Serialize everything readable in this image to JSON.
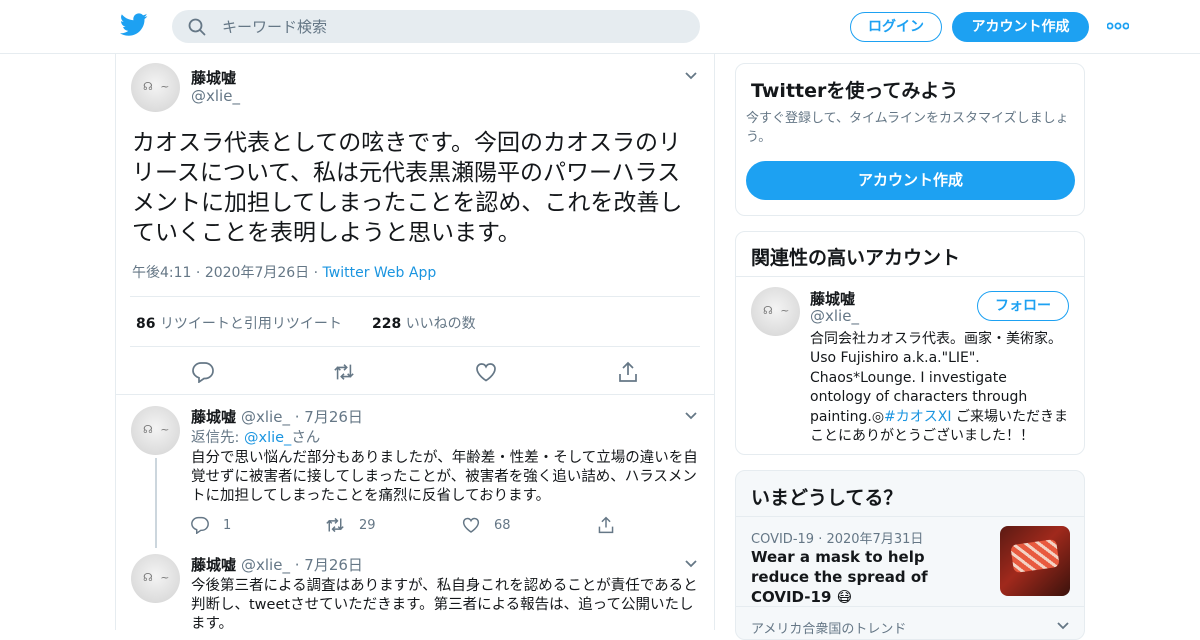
{
  "header": {
    "search_placeholder": "キーワード検索",
    "login_label": "ログイン",
    "signup_label": "アカウント作成"
  },
  "colors": {
    "accent": "#1da1f2",
    "link": "#1b95e0",
    "muted": "#657786"
  },
  "tweet": {
    "author_name": "藤城嘘",
    "author_handle": "@xlie_",
    "text": "カオスラ代表としての呟きです。今回のカオスラのリリースについて、私は元代表黒瀬陽平のパワーハラスメントに加担してしまったことを認め、これを改善していくことを表明しようと思います。",
    "time": "午後4:11",
    "date": "2020年7月26日",
    "source": "Twitter Web App",
    "retweets_count": "86",
    "retweets_label": "リツイートと引用リツイート",
    "likes_count": "228",
    "likes_label": "いいねの数"
  },
  "replies": [
    {
      "author_name": "藤城嘘",
      "author_handle": "@xlie_",
      "date": "7月26日",
      "reply_to_prefix": "返信先: ",
      "reply_to_handle": "@xlie_",
      "reply_to_suffix": "さん",
      "text": "自分で思い悩んだ部分もありましたが、年齢差・性差・そして立場の違いを自覚せずに被害者に接してしまったことが、被害者を強く追い詰め、ハラスメントに加担してしまったことを痛烈に反省しております。",
      "reply_count": "1",
      "retweet_count": "29",
      "like_count": "68"
    },
    {
      "author_name": "藤城嘘",
      "author_handle": "@xlie_",
      "date": "7月26日",
      "text": "今後第三者による調査はありますが、私自身これを認めることが責任であると判断し、tweetさせていただきます。第三者による報告は、追って公開いたします。"
    }
  ],
  "sidebar": {
    "join": {
      "title": "Twitterを使ってみよう",
      "description": "今すぐ登録して、タイムラインをカスタマイズしましょう。",
      "button_label": "アカウント作成"
    },
    "related": {
      "title": "関連性の高いアカウント",
      "name": "藤城嘘",
      "handle": "@xlie_",
      "follow_label": "フォロー",
      "bio_part1": "合同会社カオスラ代表。画家・美術家。Uso Fujishiro a.k.a.\"LIE\". Chaos*Lounge. I investigate ontology of characters through painting.◎",
      "bio_hashtag": "#カオスXI",
      "bio_part2": " ご来場いただきまことにありがとうございました！！"
    },
    "trends": {
      "title": "いまどうしてる？",
      "item_category": "COVID-19",
      "item_date": "2020年7月31日",
      "item_text": "Wear a mask to help reduce the spread of COVID-19 😷",
      "location_label": "アメリカ合衆国のトレンド"
    }
  }
}
